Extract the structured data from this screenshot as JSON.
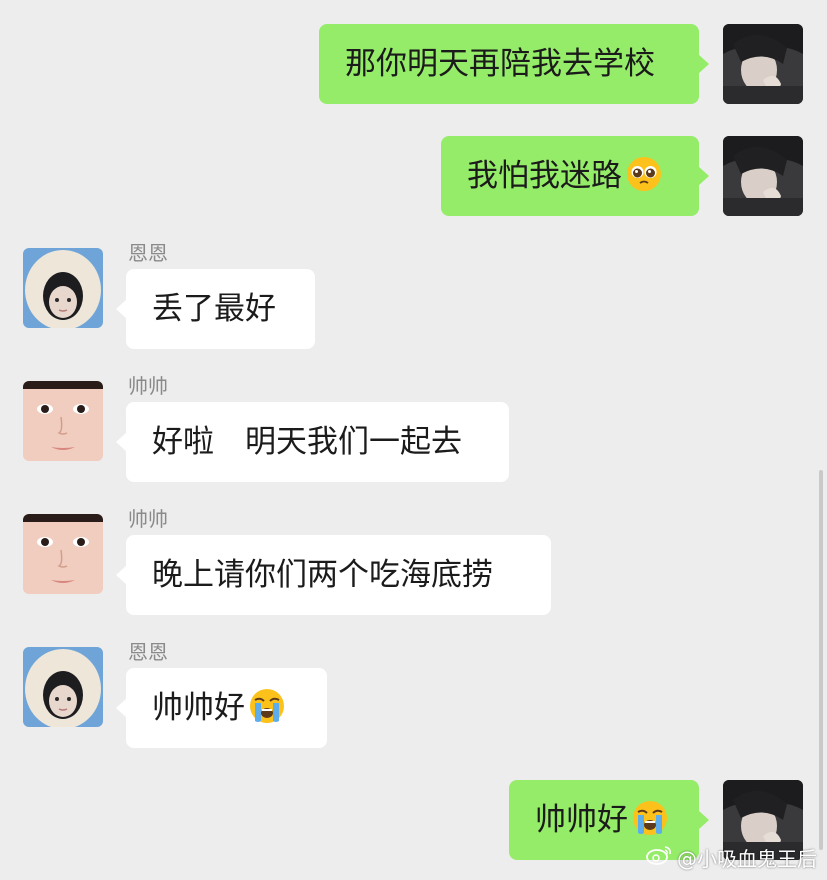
{
  "chat": {
    "messages": [
      {
        "side": "out",
        "text": "那你明天再陪我去学校",
        "emoji": ""
      },
      {
        "side": "out",
        "text": "我怕我迷路",
        "emoji": "pleading-face-icon"
      },
      {
        "side": "in",
        "sender": "恩恩",
        "text": "丢了最好",
        "emoji": ""
      },
      {
        "side": "in",
        "sender": "帅帅",
        "text": "好啦　明天我们一起去",
        "emoji": ""
      },
      {
        "side": "in",
        "sender": "帅帅",
        "text": "晚上请你们两个吃海底捞",
        "emoji": ""
      },
      {
        "side": "in",
        "sender": "恩恩",
        "text": "帅帅好",
        "emoji": "loudly-crying-face-icon"
      },
      {
        "side": "out",
        "text": "帅帅好",
        "emoji": "loudly-crying-face-icon"
      }
    ]
  },
  "watermark": {
    "text": "@小吸血鬼王后",
    "icon": "weibo-logo-icon"
  },
  "colors": {
    "background": "#ededed",
    "outgoing_bubble": "#95ec69",
    "incoming_bubble": "#ffffff",
    "sender_name": "#8a8a8a"
  }
}
